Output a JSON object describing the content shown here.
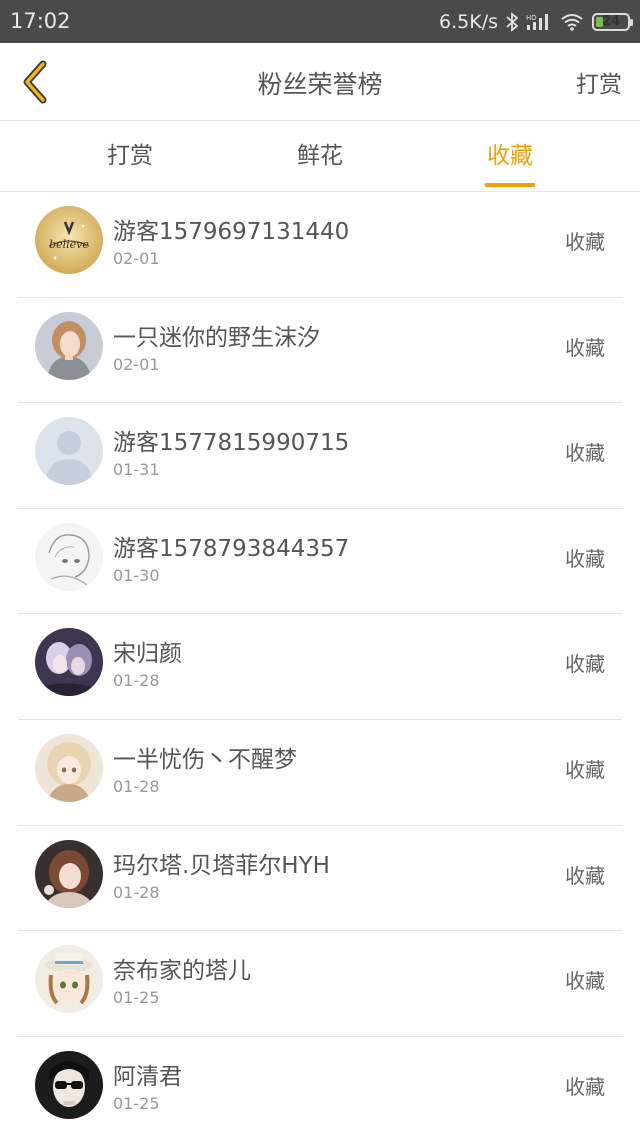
{
  "status_bar": {
    "time": "17:02",
    "net_speed": "6.5K/s",
    "battery": "24",
    "battery_level": 0.24
  },
  "header": {
    "title": "粉丝荣誉榜",
    "right_action": "打赏",
    "back_icon": "chevron-left-icon"
  },
  "tabs": [
    {
      "label": "打赏",
      "active": false
    },
    {
      "label": "鲜花",
      "active": false
    },
    {
      "label": "收藏",
      "active": true
    }
  ],
  "colors": {
    "accent": "#f0a10a",
    "status_bar": "#4a4a4a",
    "text": "#555555",
    "subtext": "#999999",
    "divider": "#e6e6e6"
  },
  "list": {
    "items": [
      {
        "name": "游客1579697131440",
        "date": "02-01",
        "action": "收藏",
        "avatar": "believe-avatar"
      },
      {
        "name": "一只迷你的野生沫汐",
        "date": "02-01",
        "action": "收藏",
        "avatar": "girl-portrait-avatar"
      },
      {
        "name": "游客1577815990715",
        "date": "01-31",
        "action": "收藏",
        "avatar": "default-user-avatar"
      },
      {
        "name": "游客1578793844357",
        "date": "01-30",
        "action": "收藏",
        "avatar": "sketch-girl-avatar"
      },
      {
        "name": "宋归颜",
        "date": "01-28",
        "action": "收藏",
        "avatar": "anime-couple-avatar"
      },
      {
        "name": "一半忧伤丶不醒梦",
        "date": "01-28",
        "action": "收藏",
        "avatar": "anime-blonde-avatar"
      },
      {
        "name": "玛尔塔.贝塔菲尔HYH",
        "date": "01-28",
        "action": "收藏",
        "avatar": "anime-brown-hair-avatar"
      },
      {
        "name": "奈布家的塔儿",
        "date": "01-25",
        "action": "收藏",
        "avatar": "chibi-hat-avatar"
      },
      {
        "name": "阿清君",
        "date": "01-25",
        "action": "收藏",
        "avatar": "sunglasses-avatar"
      }
    ]
  }
}
